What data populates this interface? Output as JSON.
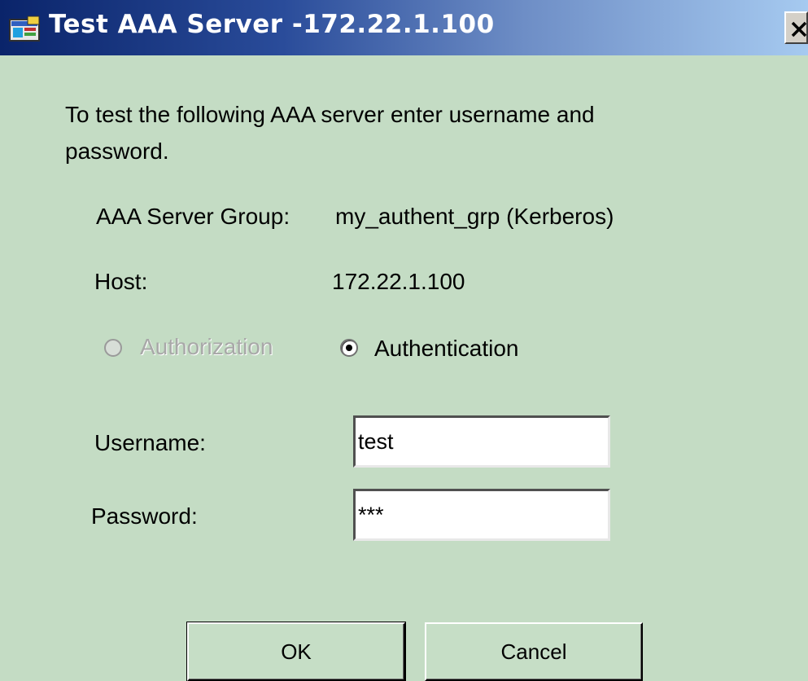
{
  "window": {
    "title": "Test AAA Server -172.22.1.100",
    "icon": "app-window-icon",
    "close_icon": "close-icon"
  },
  "dialog": {
    "intro_text": "To test the following AAA server enter username and password.",
    "server_group_label": "AAA Server Group:",
    "server_group_value": "my_authent_grp (Kerberos)",
    "host_label": "Host:",
    "host_value": "172.22.1.100",
    "radio_options": [
      {
        "label": "Authorization",
        "enabled": false,
        "selected": false
      },
      {
        "label": "Authentication",
        "enabled": true,
        "selected": true
      }
    ],
    "username_label": "Username:",
    "username_value": "test",
    "password_label": "Password:",
    "password_value": "***",
    "ok_label": "OK",
    "cancel_label": "Cancel"
  },
  "colors": {
    "background": "#c4dcc4",
    "titlebar_start": "#0a246a",
    "titlebar_end": "#a6caf0"
  }
}
